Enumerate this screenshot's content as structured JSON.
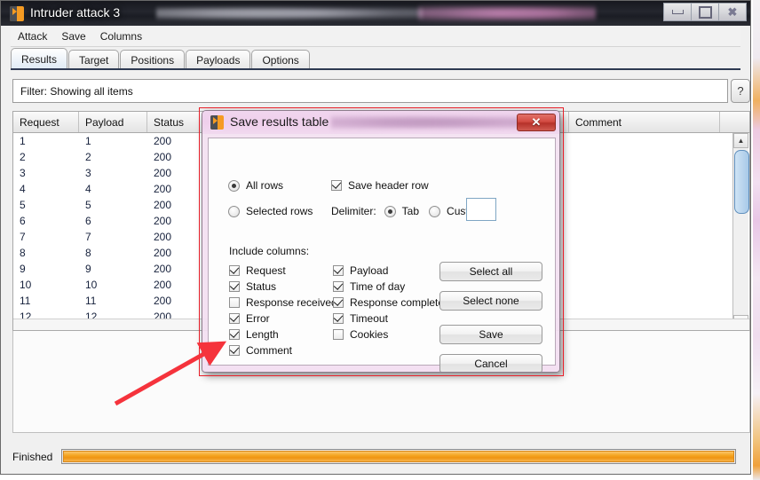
{
  "window": {
    "title": "Intruder attack 3",
    "icon": "burp-icon",
    "buttons": {
      "minimize": "minimize-icon",
      "maximize": "restore-icon",
      "close": "close-icon"
    }
  },
  "menubar": {
    "items": [
      "Attack",
      "Save",
      "Columns"
    ]
  },
  "tabs": [
    {
      "label": "Results",
      "active": true
    },
    {
      "label": "Target",
      "active": false
    },
    {
      "label": "Positions",
      "active": false
    },
    {
      "label": "Payloads",
      "active": false
    },
    {
      "label": "Options",
      "active": false
    }
  ],
  "filter": {
    "text": "Filter:  Showing all items",
    "help_label": "?"
  },
  "table": {
    "columns": [
      "Request",
      "Payload",
      "Status",
      "Comment"
    ],
    "rows": [
      [
        "1",
        "1",
        "200",
        ""
      ],
      [
        "2",
        "2",
        "200",
        ""
      ],
      [
        "3",
        "3",
        "200",
        ""
      ],
      [
        "4",
        "4",
        "200",
        ""
      ],
      [
        "5",
        "5",
        "200",
        ""
      ],
      [
        "6",
        "6",
        "200",
        ""
      ],
      [
        "7",
        "7",
        "200",
        ""
      ],
      [
        "8",
        "8",
        "200",
        ""
      ],
      [
        "9",
        "9",
        "200",
        ""
      ],
      [
        "10",
        "10",
        "200",
        ""
      ],
      [
        "11",
        "11",
        "200",
        ""
      ],
      [
        "12",
        "12",
        "200",
        ""
      ]
    ],
    "scroll_up": "▲",
    "scroll_down": "▼"
  },
  "status": {
    "label": "Finished",
    "progress_percent": 100,
    "progress_color": "#f5a623"
  },
  "dialog": {
    "title": "Save results table",
    "icon": "burp-icon",
    "close_label": "✕",
    "rows_scope": [
      {
        "label": "All rows",
        "selected": true
      },
      {
        "label": "Selected rows",
        "selected": false
      }
    ],
    "save_header_row": {
      "label": "Save header row",
      "checked": true
    },
    "delimiter": {
      "label": "Delimiter:",
      "options": [
        {
          "label": "Tab",
          "selected": true
        },
        {
          "label": "Custom:",
          "selected": false
        }
      ],
      "custom_value": ""
    },
    "include_columns_label": "Include columns:",
    "columns_left": [
      {
        "label": "Request",
        "checked": true
      },
      {
        "label": "Status",
        "checked": true
      },
      {
        "label": "Response received",
        "checked": false
      },
      {
        "label": "Error",
        "checked": true
      },
      {
        "label": "Length",
        "checked": true
      },
      {
        "label": "Comment",
        "checked": true
      }
    ],
    "columns_right": [
      {
        "label": "Payload",
        "checked": true
      },
      {
        "label": "Time of day",
        "checked": true
      },
      {
        "label": "Response completed",
        "checked": true
      },
      {
        "label": "Timeout",
        "checked": true
      },
      {
        "label": "Cookies",
        "checked": false
      }
    ],
    "buttons": [
      {
        "label": "Select all"
      },
      {
        "label": "Select none"
      },
      {
        "label": "Save"
      },
      {
        "label": "Cancel"
      }
    ]
  },
  "annotations": {
    "highlight_color": "#e8202a",
    "arrow_color": "#f5333c"
  }
}
